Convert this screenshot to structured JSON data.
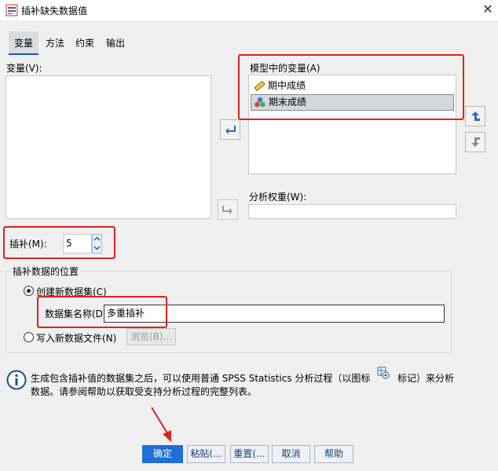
{
  "window": {
    "title": "插补缺失数据值"
  },
  "tabs": [
    {
      "label": "变量"
    },
    {
      "label": "方法"
    },
    {
      "label": "约束"
    },
    {
      "label": "输出"
    }
  ],
  "variables": {
    "label": "变量(V):",
    "items": []
  },
  "model_variables": {
    "label": "模型中的变量(A)",
    "items": [
      {
        "name": "期中成绩",
        "icon": "scale-ruler-icon",
        "selected": false
      },
      {
        "name": "期末成绩",
        "icon": "nominal-balls-icon",
        "selected": true
      }
    ]
  },
  "analysis_weight": {
    "label": "分析权重(W):",
    "value": ""
  },
  "imputations": {
    "label": "插补(M):",
    "value": "5"
  },
  "location": {
    "group_label": "插补数据的位置",
    "create_new_label": "创建新数据集(C)",
    "dataset_name_label": "数据集名称(D",
    "dataset_name_value": "多重插补",
    "write_file_label": "写入新数据文件(N)",
    "browse_label": "浏览(B)..."
  },
  "info": {
    "text1": "生成包含插补值的数据集之后，可以使用普通 SPSS Statistics 分析过程（以图标",
    "text2": "标记）来分析",
    "text3": "数据。请参阅帮助以获取受支持分析过程的完整列表。"
  },
  "buttons": {
    "ok": "确定",
    "paste": "粘贴(...",
    "reset": "重置(...",
    "cancel": "取消",
    "help": "帮助"
  },
  "colors": {
    "primary": "#1f6fd6",
    "highlight_box": "#e02020",
    "annotation_arrow": "#e02020"
  }
}
